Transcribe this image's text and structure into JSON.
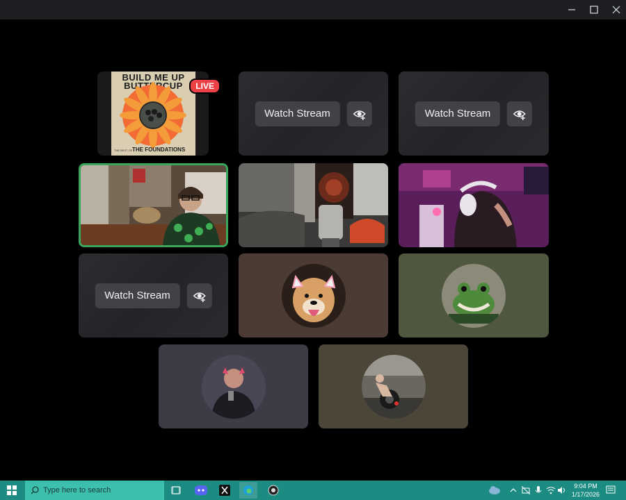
{
  "album": {
    "title_line1": "BUILD ME UP",
    "title_line2": "BUTTERCUP",
    "subtitle_small": "THE BEST OF",
    "artist": "THE FOUNDATIONS",
    "live_label": "LIVE"
  },
  "streams": {
    "watch_label": "Watch Stream"
  },
  "taskbar": {
    "search_placeholder": "Type here to search",
    "time": "9:04 PM",
    "date": "1/17/2026"
  },
  "colors": {
    "accent_green": "#3ba55c",
    "live_red": "#ed4245",
    "taskbar_bg": "#1c8c82"
  }
}
